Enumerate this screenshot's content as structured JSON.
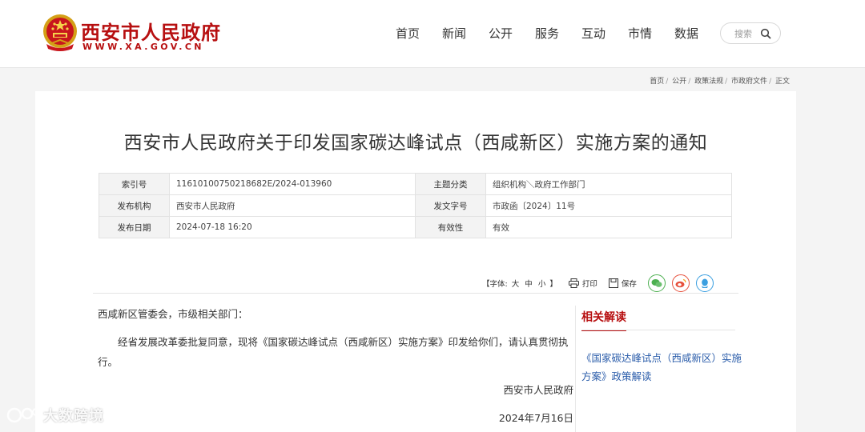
{
  "site": {
    "title": "西安市人民政府",
    "url": "WWW.XA.GOV.CN",
    "brand_color": "#b70f10"
  },
  "nav": {
    "items": [
      {
        "label": "首页"
      },
      {
        "label": "新闻"
      },
      {
        "label": "公开"
      },
      {
        "label": "服务"
      },
      {
        "label": "互动"
      },
      {
        "label": "市情"
      },
      {
        "label": "数据"
      }
    ]
  },
  "search": {
    "placeholder": "搜索",
    "icon": "search-icon"
  },
  "breadcrumb": {
    "items": [
      "首页",
      "公开",
      "政策法规",
      "市政府文件",
      "正文"
    ]
  },
  "document": {
    "title": "西安市人民政府关于印发国家碳达峰试点（西咸新区）实施方案的通知",
    "meta": {
      "index_label": "索引号",
      "index_value": "11610100750218682E/2024-013960",
      "topic_label": "主题分类",
      "topic_value": "组织机构＼政府工作部门",
      "org_label": "发布机构",
      "org_value": "西安市人民政府",
      "docno_label": "发文字号",
      "docno_value": "市政函〔2024〕11号",
      "date_label": "发布日期",
      "date_value": "2024-07-18 16:20",
      "validity_label": "有效性",
      "validity_value": "有效"
    },
    "addressee": "西咸新区管委会，市级相关部门：",
    "body": "经省发展改革委批复同意，现将《国家碳达峰试点（西咸新区）实施方案》印发给你们，请认真贯彻执行。",
    "signer": "西安市人民政府",
    "date": "2024年7月16日"
  },
  "tools": {
    "font_open": "【字体:",
    "font_large": "大",
    "font_medium": "中",
    "font_small": "小",
    "font_close": "】",
    "print_label": "打印",
    "save_label": "保存",
    "share_icons": [
      "wechat-icon",
      "weibo-icon",
      "qq-icon"
    ]
  },
  "sidebar": {
    "heading": "相关解读",
    "link": "《国家碳达峰试点（西咸新区）实施方案》政策解读"
  },
  "watermark": {
    "text": "大数跨境"
  }
}
